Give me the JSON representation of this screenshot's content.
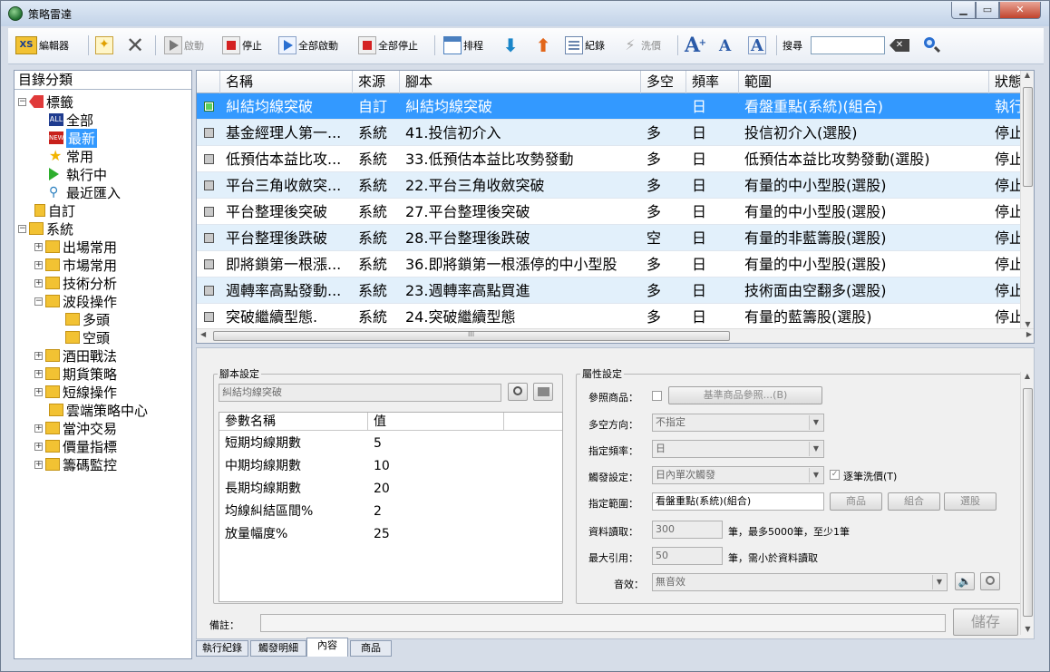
{
  "window": {
    "title": "策略雷達"
  },
  "toolbar": {
    "editor": "編輯器",
    "start": "啟動",
    "stop": "停止",
    "start_all": "全部啟動",
    "stop_all": "全部停止",
    "schedule": "排程",
    "log": "紀錄",
    "wash": "洗價",
    "search_label": "搜尋",
    "search_value": ""
  },
  "sidebar": {
    "header": "目錄分類",
    "items": [
      {
        "label": "標籤"
      },
      {
        "label": "全部"
      },
      {
        "label": "最新"
      },
      {
        "label": "常用"
      },
      {
        "label": "執行中"
      },
      {
        "label": "最近匯入"
      },
      {
        "label": "自訂"
      },
      {
        "label": "系統"
      },
      {
        "label": "出場常用"
      },
      {
        "label": "市場常用"
      },
      {
        "label": "技術分析"
      },
      {
        "label": "波段操作"
      },
      {
        "label": "多頭"
      },
      {
        "label": "空頭"
      },
      {
        "label": "酒田戰法"
      },
      {
        "label": "期貨策略"
      },
      {
        "label": "短線操作"
      },
      {
        "label": "雲端策略中心"
      },
      {
        "label": "當沖交易"
      },
      {
        "label": "價量指標"
      },
      {
        "label": "籌碼監控"
      }
    ]
  },
  "grid": {
    "columns": [
      "名稱",
      "來源",
      "腳本",
      "多空",
      "頻率",
      "範圍",
      "狀態"
    ],
    "rows": [
      {
        "name": "糾結均線突破",
        "source": "自訂",
        "script": "糾結均線突破",
        "side": "",
        "freq": "日",
        "scope": "看盤重點(系統)(組合)",
        "status": "執行"
      },
      {
        "name": "基金經理人第一...",
        "source": "系統",
        "script": "41.投信初介入",
        "side": "多",
        "freq": "日",
        "scope": "投信初介入(選股)",
        "status": "停止"
      },
      {
        "name": "低預估本益比攻...",
        "source": "系統",
        "script": "33.低預估本益比攻勢發動",
        "side": "多",
        "freq": "日",
        "scope": "低預估本益比攻勢發動(選股)",
        "status": "停止"
      },
      {
        "name": "平台三角收斂突...",
        "source": "系統",
        "script": "22.平台三角收斂突破",
        "side": "多",
        "freq": "日",
        "scope": "有量的中小型股(選股)",
        "status": "停止"
      },
      {
        "name": "平台整理後突破",
        "source": "系統",
        "script": "27.平台整理後突破",
        "side": "多",
        "freq": "日",
        "scope": "有量的中小型股(選股)",
        "status": "停止"
      },
      {
        "name": "平台整理後跌破",
        "source": "系統",
        "script": "28.平台整理後跌破",
        "side": "空",
        "freq": "日",
        "scope": "有量的非藍籌股(選股)",
        "status": "停止"
      },
      {
        "name": "即將鎖第一根漲...",
        "source": "系統",
        "script": "36.即將鎖第一根漲停的中小型股",
        "side": "多",
        "freq": "日",
        "scope": "有量的中小型股(選股)",
        "status": "停止"
      },
      {
        "name": "週轉率高點發動...",
        "source": "系統",
        "script": "23.週轉率高點買進",
        "side": "多",
        "freq": "日",
        "scope": "技術面由空翻多(選股)",
        "status": "停止"
      },
      {
        "name": "突破繼續型態.",
        "source": "系統",
        "script": "24.突破繼續型態",
        "side": "多",
        "freq": "日",
        "scope": "有量的藍籌股(選股)",
        "status": "停止"
      }
    ]
  },
  "script_panel": {
    "legend": "腳本設定",
    "script_name": "糾結均線突破",
    "param_header": "參數名稱",
    "value_header": "值",
    "params": [
      {
        "name": "短期均線期數",
        "value": "5"
      },
      {
        "name": "中期均線期數",
        "value": "10"
      },
      {
        "name": "長期均線期數",
        "value": "20"
      },
      {
        "name": "均線糾結區間%",
        "value": "2"
      },
      {
        "name": "放量幅度%",
        "value": "25"
      }
    ]
  },
  "props_panel": {
    "legend": "屬性設定",
    "ref_label": "參照商品：",
    "ref_button": "基準商品參照...(B)",
    "side_label": "多空方向：",
    "side_value": "不指定",
    "freq_label": "指定頻率：",
    "freq_value": "日",
    "trigger_label": "觸發設定：",
    "trigger_value": "日內單次觸發",
    "wash_each": "逐筆洗價(T)",
    "scope_label": "指定範圍：",
    "scope_value": "看盤重點(系統)(組合)",
    "btn_product": "商品",
    "btn_combo": "組合",
    "btn_select": "選股",
    "read_label": "資料讀取：",
    "read_value": "300",
    "read_note": "筆，最多5000筆，至少1筆",
    "ref_max_label": "最大引用：",
    "ref_max_value": "50",
    "ref_max_note": "筆，需小於資料讀取",
    "sound_label": "音效：",
    "sound_value": "無音效"
  },
  "note": {
    "label": "備註：",
    "value": "",
    "save": "儲存"
  },
  "tabs": [
    "執行紀錄",
    "觸發明細",
    "內容",
    "商品"
  ]
}
